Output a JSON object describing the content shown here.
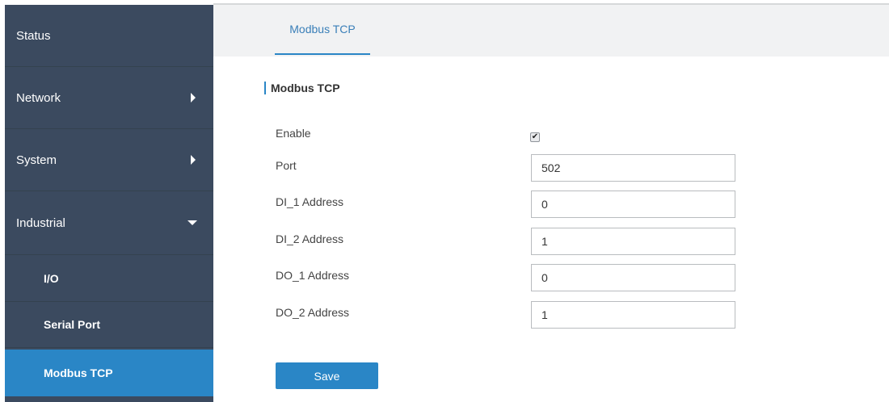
{
  "sidebar": {
    "items": [
      {
        "label": "Status",
        "icon": ""
      },
      {
        "label": "Network",
        "icon": "caret-right-icon"
      },
      {
        "label": "System",
        "icon": "caret-right-icon"
      },
      {
        "label": "Industrial",
        "icon": "caret-down-icon",
        "expanded": true
      },
      {
        "label": "I/O",
        "sub": true
      },
      {
        "label": "Serial Port",
        "sub": true
      },
      {
        "label": "Modbus TCP",
        "sub": true,
        "active": true
      }
    ]
  },
  "tabs": [
    {
      "label": "Modbus TCP",
      "active": true
    }
  ],
  "form": {
    "section_title": "Modbus TCP",
    "enable_label": "Enable",
    "enable_checked": true,
    "check_glyph": "✔",
    "fields": [
      {
        "label": "Port",
        "value": "502"
      },
      {
        "label": "DI_1 Address",
        "value": "0"
      },
      {
        "label": "DI_2 Address",
        "value": "1"
      },
      {
        "label": "DO_1 Address",
        "value": "0"
      },
      {
        "label": "DO_2 Address",
        "value": "1"
      }
    ],
    "save_label": "Save"
  },
  "colors": {
    "sidebar_bg": "#3b4a5f",
    "accent": "#2a86c6",
    "topbar_bg": "#f1f2f3"
  }
}
